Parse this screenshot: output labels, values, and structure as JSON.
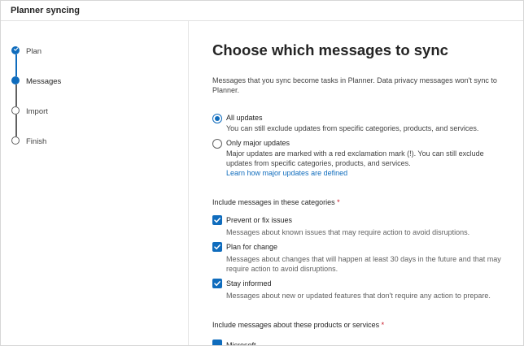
{
  "app": {
    "title": "Planner syncing"
  },
  "steps": [
    {
      "label": "Plan",
      "state": "done"
    },
    {
      "label": "Messages",
      "state": "current"
    },
    {
      "label": "Import",
      "state": "todo"
    },
    {
      "label": "Finish",
      "state": "todo"
    }
  ],
  "main": {
    "title": "Choose which messages to sync",
    "intro": "Messages that you sync become tasks in Planner. Data privacy messages won't sync to Planner.",
    "options": [
      {
        "label": "All updates",
        "desc": "You can still exclude updates from specific categories, products, and services.",
        "selected": true
      },
      {
        "label": "Only major updates",
        "desc": "Major updates are marked with a red exclamation mark (!). You can still exclude updates from specific categories, products, and services.",
        "selected": false
      }
    ],
    "learn_link": "Learn how major updates are defined",
    "categories_heading": "Include messages in these categories",
    "required_mark": "*",
    "categories": [
      {
        "label": "Prevent or fix issues",
        "desc": "Messages about known issues that may require action to avoid disruptions.",
        "checked": true
      },
      {
        "label": "Plan for change",
        "desc": "Messages about changes that will happen at least 30 days in the future and that may require action to avoid disruptions.",
        "checked": true
      },
      {
        "label": "Stay informed",
        "desc": "Messages about new or updated features that don't require any action to prepare.",
        "checked": true
      }
    ],
    "products_heading": "Include messages about these products or services",
    "products_first_label": "Microsoft Dynamics"
  },
  "colors": {
    "accent": "#0f6cbd",
    "required": "#c50f1f",
    "text": "#242424",
    "muted": "#616161"
  }
}
